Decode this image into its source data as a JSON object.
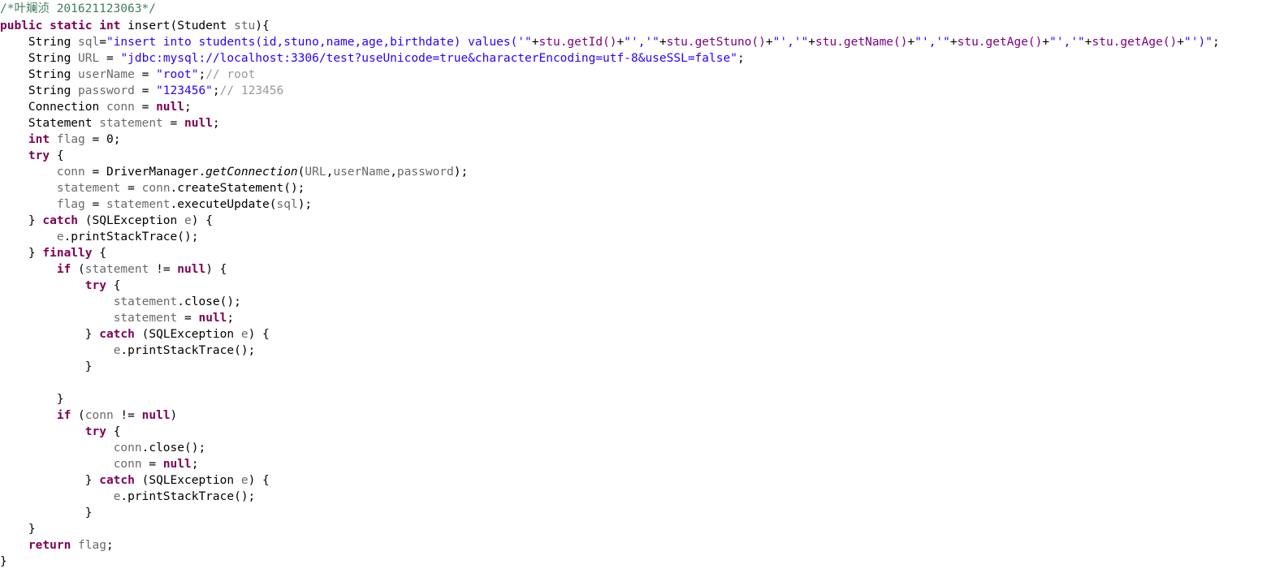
{
  "editor": {
    "language": "java",
    "background_color": "#ffffff",
    "font_size_px": 14.5,
    "line_height_px": 20,
    "theme_colors": {
      "plain_text": "#000000",
      "block_comment": "#3f7f5f",
      "line_comment": "#999999",
      "keyword": "#7f0055",
      "string_literal": "#2a00ff",
      "identifier": "#6a6a6a",
      "field": "#0000c0",
      "static_method_italic": "#000000",
      "accessor_call": "#800080"
    }
  },
  "code": {
    "line_count": 35,
    "lines": [
      {
        "n": 1,
        "text": "/*叶斓浈 201621123063*/",
        "tokens": [
          {
            "cls": "t-comment",
            "s": "/*叶斓浈 201621123063*/"
          }
        ]
      },
      {
        "n": 2,
        "text": "public static int insert(Student stu){",
        "tokens": [
          {
            "cls": "t-keyword",
            "s": "public static int"
          },
          {
            "cls": "t-plain",
            "s": " insert(Student "
          },
          {
            "cls": "t-ident",
            "s": "stu"
          },
          {
            "cls": "t-plain",
            "s": "){"
          }
        ]
      },
      {
        "n": 3,
        "text": "    String sql=\"insert into students(id,stuno,name,age,birthdate) values('\"+stu.getId()+\"','\"+stu.getStuno()+\"','\"+stu.getName()+\"','\"+stu.getAge()+\"','\"+stu.getAge()+\"')\";",
        "tokens": [
          {
            "cls": "t-plain",
            "s": "    String "
          },
          {
            "cls": "t-ident",
            "s": "sql"
          },
          {
            "cls": "t-plain",
            "s": "="
          },
          {
            "cls": "t-string",
            "s": "\"insert into students(id,stuno,name,age,birthdate) values('\""
          },
          {
            "cls": "t-plain",
            "s": "+"
          },
          {
            "cls": "t-purple",
            "s": "stu.getId()"
          },
          {
            "cls": "t-plain",
            "s": "+"
          },
          {
            "cls": "t-string",
            "s": "\"','\""
          },
          {
            "cls": "t-plain",
            "s": "+"
          },
          {
            "cls": "t-purple",
            "s": "stu.getStuno()"
          },
          {
            "cls": "t-plain",
            "s": "+"
          },
          {
            "cls": "t-string",
            "s": "\"','\""
          },
          {
            "cls": "t-plain",
            "s": "+"
          },
          {
            "cls": "t-purple",
            "s": "stu.getName()"
          },
          {
            "cls": "t-plain",
            "s": "+"
          },
          {
            "cls": "t-string",
            "s": "\"','\""
          },
          {
            "cls": "t-plain",
            "s": "+"
          },
          {
            "cls": "t-purple",
            "s": "stu.getAge()"
          },
          {
            "cls": "t-plain",
            "s": "+"
          },
          {
            "cls": "t-string",
            "s": "\"','\""
          },
          {
            "cls": "t-plain",
            "s": "+"
          },
          {
            "cls": "t-purple",
            "s": "stu.getAge()"
          },
          {
            "cls": "t-plain",
            "s": "+"
          },
          {
            "cls": "t-string",
            "s": "\"')\""
          },
          {
            "cls": "t-plain",
            "s": ";"
          }
        ]
      },
      {
        "n": 4,
        "text": "    String URL = \"jdbc:mysql://localhost:3306/test?useUnicode=true&characterEncoding=utf-8&useSSL=false\";",
        "tokens": [
          {
            "cls": "t-plain",
            "s": "    String "
          },
          {
            "cls": "t-ident",
            "s": "URL"
          },
          {
            "cls": "t-plain",
            "s": " = "
          },
          {
            "cls": "t-string",
            "s": "\"jdbc:mysql://localhost:3306/test?useUnicode=true&characterEncoding=utf-8&useSSL=false\""
          },
          {
            "cls": "t-plain",
            "s": ";"
          }
        ]
      },
      {
        "n": 5,
        "text": "    String userName = \"root\";// root",
        "tokens": [
          {
            "cls": "t-plain",
            "s": "    String "
          },
          {
            "cls": "t-ident",
            "s": "userName"
          },
          {
            "cls": "t-plain",
            "s": " = "
          },
          {
            "cls": "t-string",
            "s": "\"root\""
          },
          {
            "cls": "t-plain",
            "s": ";"
          },
          {
            "cls": "t-linecmt",
            "s": "// root"
          }
        ]
      },
      {
        "n": 6,
        "text": "    String password = \"123456\";// 123456",
        "tokens": [
          {
            "cls": "t-plain",
            "s": "    String "
          },
          {
            "cls": "t-ident",
            "s": "password"
          },
          {
            "cls": "t-plain",
            "s": " = "
          },
          {
            "cls": "t-string",
            "s": "\"123456\""
          },
          {
            "cls": "t-plain",
            "s": ";"
          },
          {
            "cls": "t-linecmt",
            "s": "// 123456"
          }
        ]
      },
      {
        "n": 7,
        "text": "    Connection conn = null;",
        "tokens": [
          {
            "cls": "t-plain",
            "s": "    Connection "
          },
          {
            "cls": "t-ident",
            "s": "conn"
          },
          {
            "cls": "t-plain",
            "s": " = "
          },
          {
            "cls": "t-keyword",
            "s": "null"
          },
          {
            "cls": "t-plain",
            "s": ";"
          }
        ]
      },
      {
        "n": 8,
        "text": "    Statement statement = null;",
        "tokens": [
          {
            "cls": "t-plain",
            "s": "    Statement "
          },
          {
            "cls": "t-ident",
            "s": "statement"
          },
          {
            "cls": "t-plain",
            "s": " = "
          },
          {
            "cls": "t-keyword",
            "s": "null"
          },
          {
            "cls": "t-plain",
            "s": ";"
          }
        ]
      },
      {
        "n": 9,
        "text": "    int flag = 0;",
        "tokens": [
          {
            "cls": "t-plain",
            "s": "    "
          },
          {
            "cls": "t-keyword",
            "s": "int"
          },
          {
            "cls": "t-plain",
            "s": " "
          },
          {
            "cls": "t-ident",
            "s": "flag"
          },
          {
            "cls": "t-plain",
            "s": " = 0;"
          }
        ]
      },
      {
        "n": 10,
        "text": "    try {",
        "tokens": [
          {
            "cls": "t-plain",
            "s": "    "
          },
          {
            "cls": "t-keyword",
            "s": "try"
          },
          {
            "cls": "t-plain",
            "s": " {"
          }
        ]
      },
      {
        "n": 11,
        "text": "        conn = DriverManager.getConnection(URL,userName,password);",
        "tokens": [
          {
            "cls": "t-plain",
            "s": "        "
          },
          {
            "cls": "t-ident",
            "s": "conn"
          },
          {
            "cls": "t-plain",
            "s": " = DriverManager."
          },
          {
            "cls": "t-static",
            "s": "getConnection"
          },
          {
            "cls": "t-plain",
            "s": "("
          },
          {
            "cls": "t-ident",
            "s": "URL"
          },
          {
            "cls": "t-plain",
            "s": ","
          },
          {
            "cls": "t-ident",
            "s": "userName"
          },
          {
            "cls": "t-plain",
            "s": ","
          },
          {
            "cls": "t-ident",
            "s": "password"
          },
          {
            "cls": "t-plain",
            "s": ");"
          }
        ]
      },
      {
        "n": 12,
        "text": "        statement = conn.createStatement();",
        "tokens": [
          {
            "cls": "t-plain",
            "s": "        "
          },
          {
            "cls": "t-ident",
            "s": "statement"
          },
          {
            "cls": "t-plain",
            "s": " = "
          },
          {
            "cls": "t-ident",
            "s": "conn"
          },
          {
            "cls": "t-plain",
            "s": ".createStatement();"
          }
        ]
      },
      {
        "n": 13,
        "text": "        flag = statement.executeUpdate(sql);",
        "tokens": [
          {
            "cls": "t-plain",
            "s": "        "
          },
          {
            "cls": "t-ident",
            "s": "flag"
          },
          {
            "cls": "t-plain",
            "s": " = "
          },
          {
            "cls": "t-ident",
            "s": "statement"
          },
          {
            "cls": "t-plain",
            "s": ".executeUpdate("
          },
          {
            "cls": "t-ident",
            "s": "sql"
          },
          {
            "cls": "t-plain",
            "s": ");"
          }
        ]
      },
      {
        "n": 14,
        "text": "    } catch (SQLException e) {",
        "tokens": [
          {
            "cls": "t-plain",
            "s": "    } "
          },
          {
            "cls": "t-keyword",
            "s": "catch"
          },
          {
            "cls": "t-plain",
            "s": " (SQLException "
          },
          {
            "cls": "t-ident",
            "s": "e"
          },
          {
            "cls": "t-plain",
            "s": ") {"
          }
        ]
      },
      {
        "n": 15,
        "text": "        e.printStackTrace();",
        "tokens": [
          {
            "cls": "t-plain",
            "s": "        "
          },
          {
            "cls": "t-ident",
            "s": "e"
          },
          {
            "cls": "t-plain",
            "s": ".printStackTrace();"
          }
        ]
      },
      {
        "n": 16,
        "text": "    } finally {",
        "tokens": [
          {
            "cls": "t-plain",
            "s": "    } "
          },
          {
            "cls": "t-keyword",
            "s": "finally"
          },
          {
            "cls": "t-plain",
            "s": " {"
          }
        ]
      },
      {
        "n": 17,
        "text": "        if (statement != null) {",
        "tokens": [
          {
            "cls": "t-plain",
            "s": "        "
          },
          {
            "cls": "t-keyword",
            "s": "if"
          },
          {
            "cls": "t-plain",
            "s": " ("
          },
          {
            "cls": "t-ident",
            "s": "statement"
          },
          {
            "cls": "t-plain",
            "s": " != "
          },
          {
            "cls": "t-keyword",
            "s": "null"
          },
          {
            "cls": "t-plain",
            "s": ") {"
          }
        ]
      },
      {
        "n": 18,
        "text": "            try {",
        "tokens": [
          {
            "cls": "t-plain",
            "s": "            "
          },
          {
            "cls": "t-keyword",
            "s": "try"
          },
          {
            "cls": "t-plain",
            "s": " {"
          }
        ]
      },
      {
        "n": 19,
        "text": "                statement.close();",
        "tokens": [
          {
            "cls": "t-plain",
            "s": "                "
          },
          {
            "cls": "t-ident",
            "s": "statement"
          },
          {
            "cls": "t-plain",
            "s": ".close();"
          }
        ]
      },
      {
        "n": 20,
        "text": "                statement = null;",
        "tokens": [
          {
            "cls": "t-plain",
            "s": "                "
          },
          {
            "cls": "t-ident",
            "s": "statement"
          },
          {
            "cls": "t-plain",
            "s": " = "
          },
          {
            "cls": "t-keyword",
            "s": "null"
          },
          {
            "cls": "t-plain",
            "s": ";"
          }
        ]
      },
      {
        "n": 21,
        "text": "            } catch (SQLException e) {",
        "tokens": [
          {
            "cls": "t-plain",
            "s": "            } "
          },
          {
            "cls": "t-keyword",
            "s": "catch"
          },
          {
            "cls": "t-plain",
            "s": " (SQLException "
          },
          {
            "cls": "t-ident",
            "s": "e"
          },
          {
            "cls": "t-plain",
            "s": ") {"
          }
        ]
      },
      {
        "n": 22,
        "text": "                e.printStackTrace();",
        "tokens": [
          {
            "cls": "t-plain",
            "s": "                "
          },
          {
            "cls": "t-ident",
            "s": "e"
          },
          {
            "cls": "t-plain",
            "s": ".printStackTrace();"
          }
        ]
      },
      {
        "n": 23,
        "text": "            }",
        "tokens": [
          {
            "cls": "t-plain",
            "s": "            }"
          }
        ]
      },
      {
        "n": 24,
        "text": "",
        "tokens": []
      },
      {
        "n": 25,
        "text": "        }",
        "tokens": [
          {
            "cls": "t-plain",
            "s": "        }"
          }
        ]
      },
      {
        "n": 26,
        "text": "        if (conn != null)",
        "tokens": [
          {
            "cls": "t-plain",
            "s": "        "
          },
          {
            "cls": "t-keyword",
            "s": "if"
          },
          {
            "cls": "t-plain",
            "s": " ("
          },
          {
            "cls": "t-ident",
            "s": "conn"
          },
          {
            "cls": "t-plain",
            "s": " != "
          },
          {
            "cls": "t-keyword",
            "s": "null"
          },
          {
            "cls": "t-plain",
            "s": ")"
          }
        ]
      },
      {
        "n": 27,
        "text": "            try {",
        "tokens": [
          {
            "cls": "t-plain",
            "s": "            "
          },
          {
            "cls": "t-keyword",
            "s": "try"
          },
          {
            "cls": "t-plain",
            "s": " {"
          }
        ]
      },
      {
        "n": 28,
        "text": "                conn.close();",
        "tokens": [
          {
            "cls": "t-plain",
            "s": "                "
          },
          {
            "cls": "t-ident",
            "s": "conn"
          },
          {
            "cls": "t-plain",
            "s": ".close();"
          }
        ]
      },
      {
        "n": 29,
        "text": "                conn = null;",
        "tokens": [
          {
            "cls": "t-plain",
            "s": "                "
          },
          {
            "cls": "t-ident",
            "s": "conn"
          },
          {
            "cls": "t-plain",
            "s": " = "
          },
          {
            "cls": "t-keyword",
            "s": "null"
          },
          {
            "cls": "t-plain",
            "s": ";"
          }
        ]
      },
      {
        "n": 30,
        "text": "            } catch (SQLException e) {",
        "tokens": [
          {
            "cls": "t-plain",
            "s": "            } "
          },
          {
            "cls": "t-keyword",
            "s": "catch"
          },
          {
            "cls": "t-plain",
            "s": " (SQLException "
          },
          {
            "cls": "t-ident",
            "s": "e"
          },
          {
            "cls": "t-plain",
            "s": ") {"
          }
        ]
      },
      {
        "n": 31,
        "text": "                e.printStackTrace();",
        "tokens": [
          {
            "cls": "t-plain",
            "s": "                "
          },
          {
            "cls": "t-ident",
            "s": "e"
          },
          {
            "cls": "t-plain",
            "s": ".printStackTrace();"
          }
        ]
      },
      {
        "n": 32,
        "text": "            }",
        "tokens": [
          {
            "cls": "t-plain",
            "s": "            }"
          }
        ]
      },
      {
        "n": 33,
        "text": "    }",
        "tokens": [
          {
            "cls": "t-plain",
            "s": "    }"
          }
        ]
      },
      {
        "n": 34,
        "text": "    return flag;",
        "tokens": [
          {
            "cls": "t-plain",
            "s": "    "
          },
          {
            "cls": "t-keyword",
            "s": "return"
          },
          {
            "cls": "t-plain",
            "s": " "
          },
          {
            "cls": "t-ident",
            "s": "flag"
          },
          {
            "cls": "t-plain",
            "s": ";"
          }
        ]
      },
      {
        "n": 35,
        "text": "}",
        "tokens": [
          {
            "cls": "t-plain",
            "s": "}"
          }
        ]
      }
    ]
  }
}
